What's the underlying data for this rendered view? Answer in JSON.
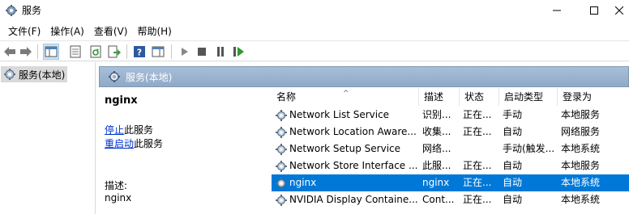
{
  "window": {
    "title": "服务"
  },
  "menu": [
    "文件(F)",
    "操作(A)",
    "查看(V)",
    "帮助(H)"
  ],
  "tree": {
    "item_label": "服务(本地)"
  },
  "panel": {
    "header": "服务(本地)"
  },
  "description": {
    "service_name": "nginx",
    "stop_link": "停止",
    "stop_suffix": "此服务",
    "restart_link": "重启动",
    "restart_suffix": "此服务",
    "desc_label": "描述:",
    "desc_value": "nginx"
  },
  "columns": [
    "名称",
    "描述",
    "状态",
    "启动类型",
    "登录为"
  ],
  "rows": [
    [
      "Network List Service",
      "识别...",
      "正在...",
      "手动",
      "本地服务"
    ],
    [
      "Network Location Aware...",
      "收集...",
      "正在...",
      "自动",
      "网络服务"
    ],
    [
      "Network Setup Service",
      "网络...",
      "",
      "手动(触发...",
      "本地系统"
    ],
    [
      "Network Store Interface ...",
      "此服...",
      "正在...",
      "自动",
      "本地服务"
    ],
    [
      "nginx",
      "nginx",
      "正在...",
      "自动",
      "本地系统"
    ],
    [
      "NVIDIA Display Containe...",
      "Cont...",
      "正在...",
      "自动",
      "本地系统"
    ]
  ],
  "selected_row": 4,
  "colors": {
    "selection": "#0078d7",
    "link": "#0033cc",
    "header_bg": "#97afc9"
  }
}
